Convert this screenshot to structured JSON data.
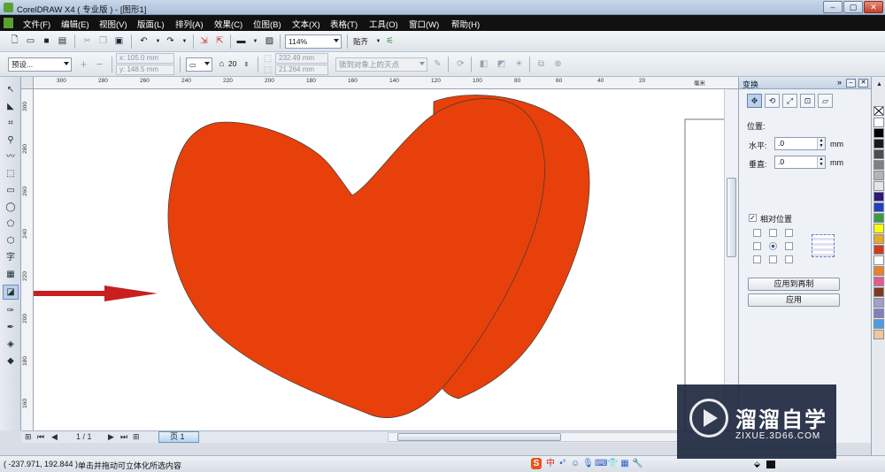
{
  "window": {
    "title": "CorelDRAW X4 ( 专业版 ) - [图形1]",
    "minimize": "–",
    "maximize": "▢",
    "close": "✕"
  },
  "menu": [
    "文件(F)",
    "编辑(E)",
    "视图(V)",
    "版面(L)",
    "排列(A)",
    "效果(C)",
    "位图(B)",
    "文本(X)",
    "表格(T)",
    "工具(O)",
    "窗口(W)",
    "帮助(H)"
  ],
  "toolbar": {
    "zoom": "114%",
    "snap": "贴齐"
  },
  "propertybar": {
    "preset": "预设...",
    "x": "x: 105.0 mm",
    "y": "y: 148.5 mm",
    "depth": "20",
    "vp_x": "232.49 mm",
    "vp_y": "21.264 mm",
    "vp_lock": "锁到对象上的灭点"
  },
  "ruler": {
    "h_ticks": [
      "300",
      "280",
      "260",
      "240",
      "220",
      "200",
      "180",
      "160",
      "140",
      "120",
      "100",
      "80",
      "60",
      "40",
      "20"
    ],
    "h_unit": "毫米",
    "v_ticks": [
      "300",
      "280",
      "260",
      "240",
      "220",
      "200",
      "180",
      "160"
    ]
  },
  "page_nav": {
    "counter": "1 / 1",
    "tab": "页 1"
  },
  "docker": {
    "title": "变换",
    "position_label": "位置:",
    "h_label": "水平:",
    "h_value": ".0",
    "v_label": "垂直:",
    "v_value": ".0",
    "unit": "mm",
    "relative_label": "相对位置",
    "relative_checked": true,
    "apply_copy": "应用到再制",
    "apply": "应用"
  },
  "palette": [
    "#ffffff",
    "#000000",
    "#1a1a1a",
    "#4d4d4d",
    "#808080",
    "#b3b3b3",
    "#e6e6e6",
    "#2e1a78",
    "#2040c0",
    "#3c9b3c",
    "#ffff00",
    "#e8aa20",
    "#d33a1a",
    "#ffffff",
    "#f08020",
    "#e85a8a",
    "#7d3a1e",
    "#a0a0c8",
    "#8080c0",
    "#4d9de0",
    "#f2c6a0"
  ],
  "heart_color": "#e8400a",
  "status": {
    "coords": "( -237.971, 192.844 )",
    "message": "单击并拖动可立体化所选内容"
  },
  "watermark": {
    "name": "溜溜自学",
    "url": "ZIXUE.3D66.COM"
  }
}
